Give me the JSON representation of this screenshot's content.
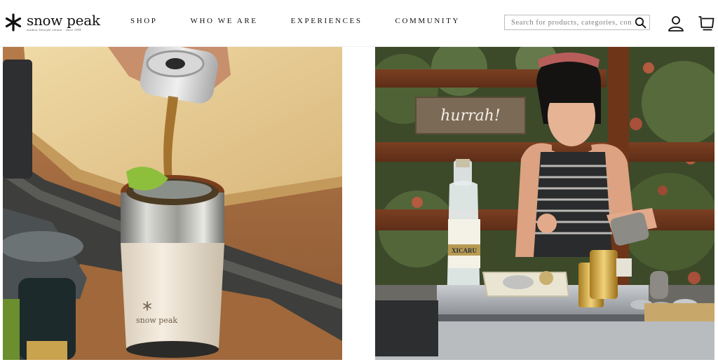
{
  "brand": {
    "name": "snow peak",
    "tagline": "outdoor lifestyle creator · since 1958"
  },
  "nav": {
    "items": [
      {
        "label": "SHOP"
      },
      {
        "label": "WHO WE ARE"
      },
      {
        "label": "EXPERIENCES"
      },
      {
        "label": "COMMUNITY"
      }
    ]
  },
  "search": {
    "placeholder": "Search for products, categories, content",
    "value": ""
  },
  "icons": {
    "search": "search-icon",
    "account": "user-icon",
    "cart": "cart-icon",
    "logo": "snowflake-icon"
  },
  "photos": {
    "left": {
      "tumbler_brand": "snow peak"
    },
    "right": {
      "sign_text": "hurrah!",
      "bottle_label": "XICARU"
    }
  },
  "colors": {
    "accent": "#111111",
    "background": "#ffffff"
  }
}
